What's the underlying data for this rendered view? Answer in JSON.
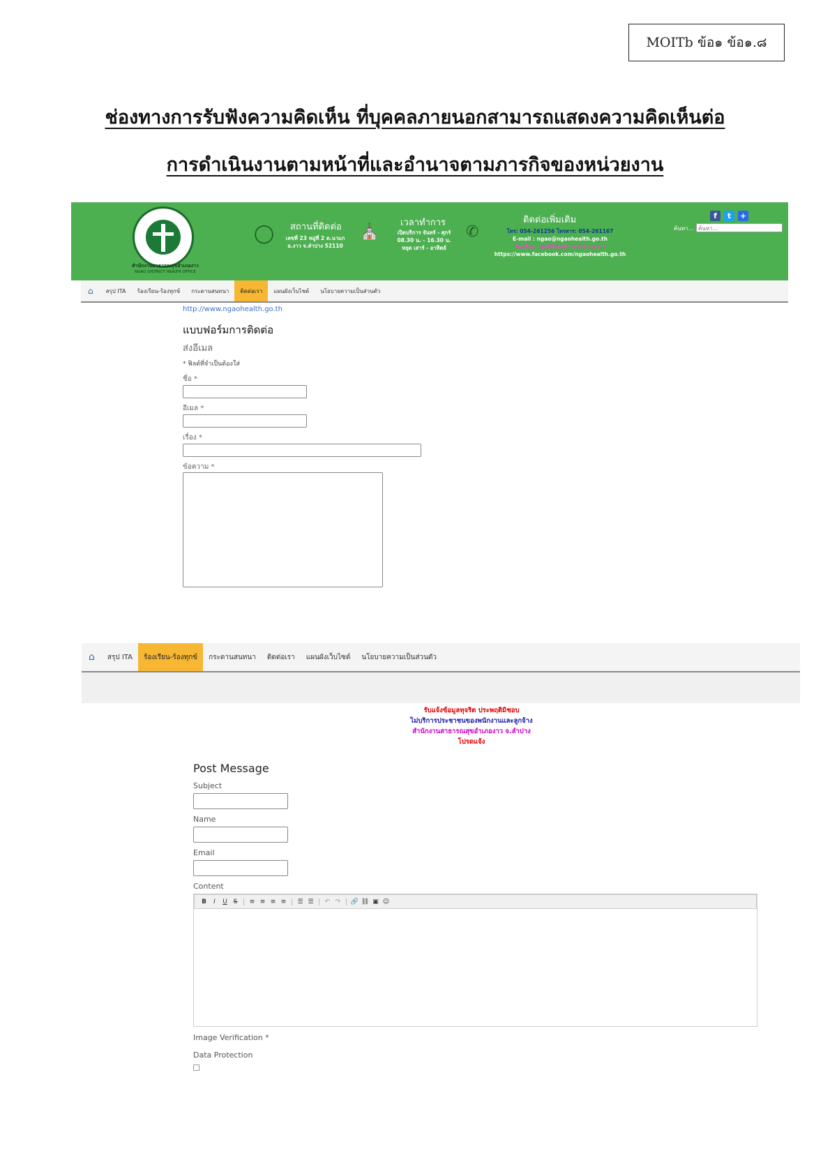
{
  "doc": {
    "code": "MOITb ข้อ๑ ข้อ๑.๘",
    "title_line1": "ช่องทางการรับฟังความคิดเห็น ที่บุคคลภายนอกสามารถแสดงความคิดเห็นต่อ",
    "title_line2": "การดำเนินงานตามหน้าที่และอำนาจตามภารกิจของหน่วยงาน"
  },
  "header": {
    "office_name_th": "สำนักงานสาธารณสุขอำเภองาว",
    "office_name_en": "NGAO DISTRICT HEALTH OFFICE",
    "location_title": "สถานที่ติดต่อ",
    "location_line1": "เลขที่ 23 หมู่ที่ 2 ต.นาแก",
    "location_line2": "อ.งาว จ.ลำปาง 52110",
    "hours_title": "เวลาทำการ",
    "hours_line1": "เปิดบริการ จันทร์ - ศุกร์",
    "hours_line2": "08.30 น. - 16.30 น.",
    "hours_line3": "หยุด เสาร์ - อาทิตย์",
    "contact_title": "ติดต่อเพิ่มเติม",
    "contact_phone": "โทร: 054-261256 โทรสาร: 054-261167",
    "contact_email": "E-mail : ngao@ngaohealth.go.th",
    "contact_line": "ร้องเรียน : ศูนย์ข้อมูลข่าวสารอำเภองาว",
    "contact_fb": "https://www.facebook.com/ngaohealth.go.th",
    "search_label": "ค้นหา...",
    "search_placeholder": "ค้นหา...",
    "social": [
      "f",
      "t",
      "+"
    ]
  },
  "nav1": {
    "items": [
      "สรุป ITA",
      "ร้องเรียน-ร้องทุกข์",
      "กระดานสนทนา",
      "ติดต่อเรา",
      "แผนผังเว็บไซต์",
      "นโยบายความเป็นส่วนตัว"
    ],
    "active_index": 3
  },
  "contact_form": {
    "url": "http://www.ngaohealth.go.th",
    "heading": "แบบฟอร์มการติดต่อ",
    "subheading": "ส่งอีเมล",
    "required_note": "* ฟิลด์ที่จำเป็นต้องใส่",
    "name_label": "ชื่อ *",
    "email_label": "อีเมล *",
    "subject_label": "เรื่อง *",
    "message_label": "ข้อความ *"
  },
  "nav2": {
    "items": [
      "สรุป ITA",
      "ร้องเรียน-ร้องทุกข์",
      "กระดานสนทนา",
      "ติดต่อเรา",
      "แผนผังเว็บไซต์",
      "นโยบายความเป็นส่วนตัว"
    ],
    "active_index": 1
  },
  "notice": {
    "line1": "รับแจ้งข้อมูลทุจริต ประพฤติมิชอบ",
    "line2": "ไม่บริการประชาชนของพนักงานและลูกจ้าง",
    "line3": "สำนักงานสาธารณสุขอำเภองาว จ.ลำปาง",
    "line4": "โปรดแจ้ง"
  },
  "post_message": {
    "heading": "Post Message",
    "subject_label": "Subject",
    "name_label": "Name",
    "email_label": "Email",
    "content_label": "Content",
    "image_verification_label": "Image Verification *",
    "data_protection_label": "Data Protection",
    "toolbar": [
      "B",
      "I",
      "U",
      "S",
      "|",
      "≡",
      "≡",
      "≡",
      "≡",
      "|",
      "☰",
      "☰",
      "|",
      "↶",
      "↷",
      "|",
      "🔗",
      "⛓",
      "▣",
      "☺"
    ]
  },
  "colors": {
    "header_green": "#4caf50",
    "nav_active": "#f7b733",
    "notice_red": "#e00000",
    "notice_blue": "#1a1aa8",
    "notice_magenta": "#cc00cc"
  }
}
